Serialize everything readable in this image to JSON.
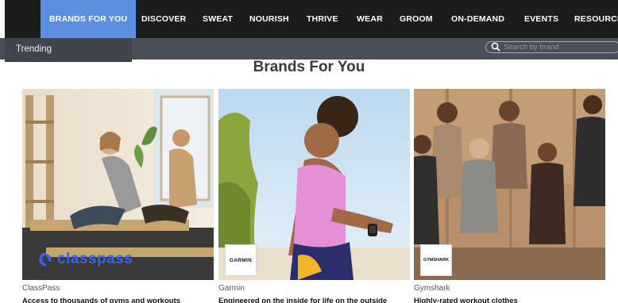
{
  "nav": {
    "items": [
      {
        "label": "BRANDS FOR YOU",
        "active": true
      },
      {
        "label": "DISCOVER"
      },
      {
        "label": "SWEAT"
      },
      {
        "label": "NOURISH"
      },
      {
        "label": "THRIVE"
      },
      {
        "label": "WEAR"
      },
      {
        "label": "GROOM"
      },
      {
        "label": "ON-DEMAND"
      },
      {
        "label": "EVENTS"
      },
      {
        "label": "RESOURCE"
      }
    ],
    "active_color": "#5b8fe0"
  },
  "dropdown": {
    "item": "Trending"
  },
  "search": {
    "placeholder": "Search by brand"
  },
  "page": {
    "title": "Brands For You"
  },
  "brands": [
    {
      "name": "ClassPass",
      "description": "Access to thousands of gyms and workouts",
      "logo_text": "classpass",
      "logo_color": "#3b63e8"
    },
    {
      "name": "Garmin",
      "description": "Engineered on the inside for life on the outside",
      "logo_text": "GARMIN"
    },
    {
      "name": "Gymshark",
      "description": "Highly-rated workout clothes",
      "logo_text": "GYMSHARK"
    }
  ]
}
